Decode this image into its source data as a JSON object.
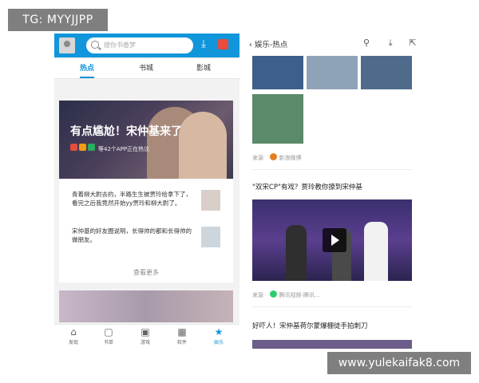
{
  "watermarks": {
    "top": "TG: MYYJJPP",
    "bottom": "www.yulekaifak8.com"
  },
  "left_phone": {
    "search_placeholder": "搜你书香梦",
    "tabs": [
      {
        "label": "热点"
      },
      {
        "label": "书城"
      },
      {
        "label": "影城"
      }
    ],
    "feature": {
      "headline": "有点尴尬！宋仲基来了",
      "subline": "等42个APP正在热议"
    },
    "stories": [
      {
        "text": "青着柳大尉去的，半路生生被贾玲给拿下了，看完之后我竟然开始yy贾玲和柳大尉了。"
      },
      {
        "text": "宋仲基的好友圈说明，长得帅的都和长得帅的做朋友。"
      }
    ],
    "more_label": "查看更多",
    "nav": [
      {
        "label": "发现",
        "icon": "home-icon"
      },
      {
        "label": "书单",
        "icon": "basket-icon"
      },
      {
        "label": "游戏",
        "icon": "gamepad-icon"
      },
      {
        "label": "软件",
        "icon": "apps-icon"
      },
      {
        "label": "娱乐",
        "icon": "star-icon"
      }
    ],
    "accent_color": "#1296db"
  },
  "right_phone": {
    "title": "娱乐-热点",
    "source1": {
      "prefix": "来源",
      "name": "新浪微博"
    },
    "article2": {
      "title": "\"双宋CP\"有戏？贾玲教你撩到宋仲基"
    },
    "source2": {
      "prefix": "来源",
      "name": "腾讯视频-腾讯..."
    },
    "article3": {
      "title": "好吓人！宋仲基荷尔蒙爆棚徒手拍刺刀"
    }
  }
}
